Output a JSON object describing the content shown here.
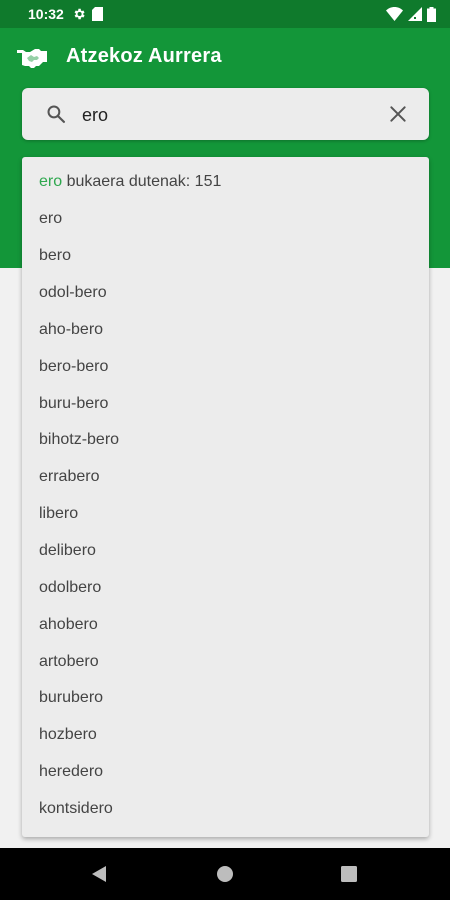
{
  "status_bar": {
    "time": "10:32",
    "left_icons": [
      "gear-icon",
      "sd-card-icon"
    ],
    "right_icons": [
      "wifi-icon",
      "signal-icon",
      "battery-icon"
    ]
  },
  "app_bar": {
    "title": "Atzekoz Aurrera",
    "logo_icon": "handshake-icon",
    "color": "#139639"
  },
  "search": {
    "value": "ero",
    "search_icon": "search-icon",
    "clear_icon": "close-icon"
  },
  "suggestions": {
    "header_highlight": "ero",
    "header_text": " bukaera dutenak: 151",
    "highlight_color": "#2fa84f",
    "items": [
      "ero",
      "bero",
      "odol-bero",
      "aho-bero",
      "bero-bero",
      "buru-bero",
      "bihotz-bero",
      "errabero",
      "libero",
      "delibero",
      "odolbero",
      "ahobero",
      "artobero",
      "burubero",
      "hozbero",
      "heredero",
      "kontsidero"
    ]
  },
  "nav_bar": {
    "icons": [
      "back-icon",
      "home-icon",
      "recents-icon"
    ]
  }
}
